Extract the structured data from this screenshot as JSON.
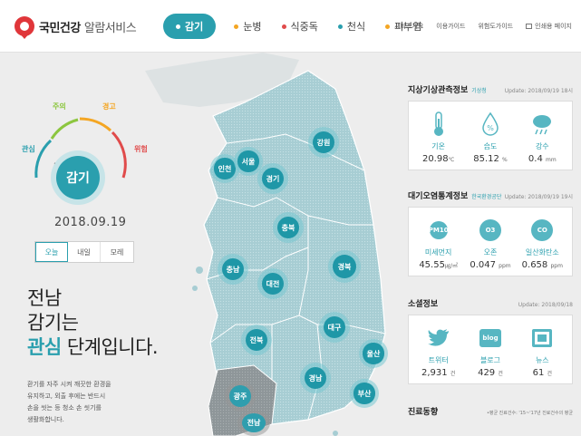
{
  "header": {
    "logo_title": "국민건강",
    "logo_sub": "알람서비스",
    "nav": [
      {
        "label": "감기",
        "color": "#ffffff",
        "active": true
      },
      {
        "label": "눈병",
        "color": "#f4a623"
      },
      {
        "label": "식중독",
        "color": "#e04b4b"
      },
      {
        "label": "천식",
        "color": "#2a9fae"
      },
      {
        "label": "피부염",
        "color": "#f4a623"
      }
    ],
    "util": [
      "서비스개요",
      "이용가이드",
      "위험도가이드",
      "인쇄용 페이지"
    ]
  },
  "gauge": {
    "levels": [
      "관심",
      "주의",
      "경고",
      "위험"
    ],
    "level_colors": [
      "#2a9fae",
      "#8cc63f",
      "#f4a623",
      "#e04b4b"
    ],
    "current_disease": "감기",
    "current_level": "관심",
    "date": "2018.09.19"
  },
  "day_tabs": [
    "오늘",
    "내일",
    "모레"
  ],
  "headline": {
    "region": "전남",
    "line2": "감기는",
    "level": "관심",
    "tail": "단계입니다."
  },
  "advice": [
    "환기를 자주 시켜 깨끗한 환경을",
    "유지하고, 외출 후에는 반드시",
    "손을 씻는 등 청소 손 씻기를",
    "생활화합니다."
  ],
  "regions": [
    "인천",
    "서울",
    "강원",
    "경기",
    "충북",
    "충남",
    "대전",
    "경북",
    "대구",
    "전북",
    "울산",
    "경남",
    "부산",
    "광주",
    "전남"
  ],
  "weather": {
    "title": "지상기상관측정보",
    "source": "기상청",
    "updated": "Update: 2018/09/19 18시",
    "items": [
      {
        "label": "기온",
        "value": "20.98",
        "unit": "℃",
        "icon": "thermometer-icon"
      },
      {
        "label": "습도",
        "value": "85.12",
        "unit": "%",
        "icon": "humidity-icon"
      },
      {
        "label": "강수",
        "value": "0.4",
        "unit": "mm",
        "icon": "rain-icon"
      }
    ]
  },
  "air": {
    "title": "대기오염통계정보",
    "source": "한국환경공단",
    "updated": "Update: 2018/09/19 19시",
    "items": [
      {
        "label": "미세먼지",
        "badge": "PM10",
        "value": "45.55",
        "unit": "㎍/㎥"
      },
      {
        "label": "오존",
        "badge": "O3",
        "value": "0.047",
        "unit": "ppm"
      },
      {
        "label": "일산화탄소",
        "badge": "CO",
        "value": "0.658",
        "unit": "ppm"
      }
    ]
  },
  "social": {
    "title": "소셜정보",
    "updated": "Update: 2018/09/18",
    "items": [
      {
        "label": "트위터",
        "value": "2,931",
        "unit": "건",
        "icon": "twitter-icon"
      },
      {
        "label": "블로그",
        "value": "429",
        "unit": "건",
        "icon": "blog-icon",
        "badge": "blog"
      },
      {
        "label": "뉴스",
        "value": "61",
        "unit": "건",
        "icon": "news-icon"
      }
    ]
  },
  "trend": {
    "title": "진료동향",
    "note": "•평균 진료건수: '15~'17년 진료건수의 평균"
  }
}
